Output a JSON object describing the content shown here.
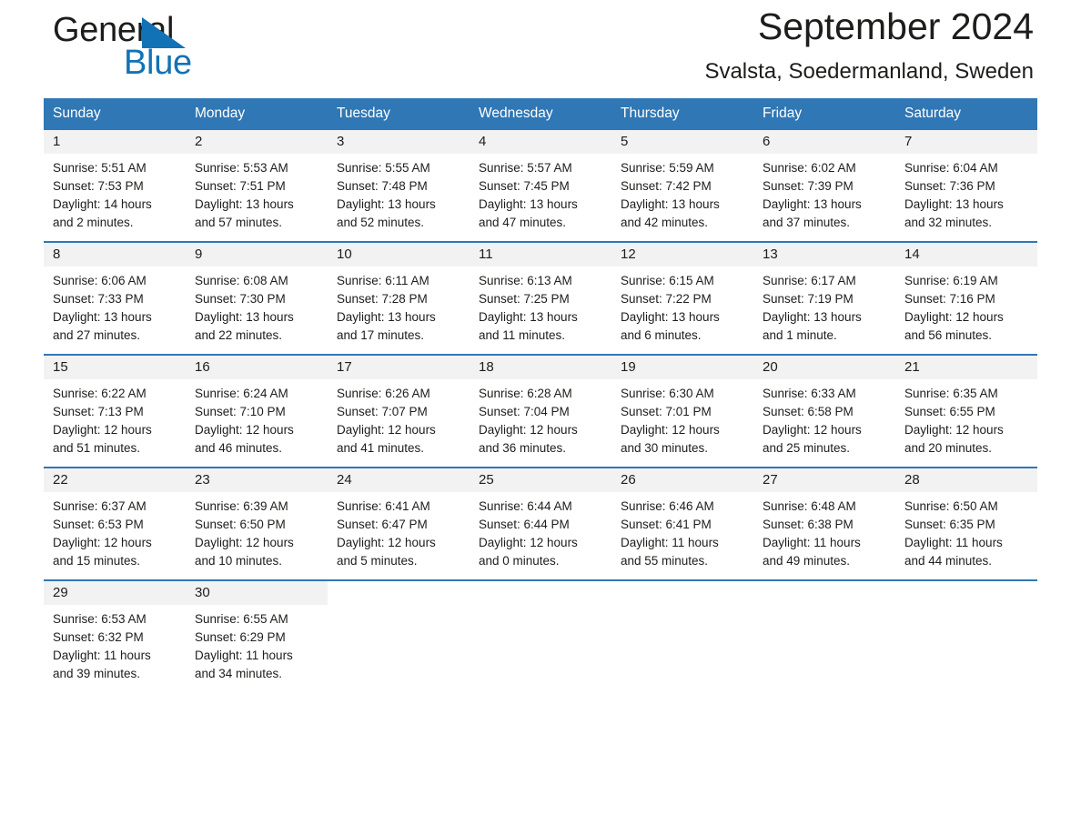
{
  "brand": {
    "name_part1": "General",
    "name_part2": "Blue",
    "triangle_color": "#1272b6",
    "accent_color": "#3077b5"
  },
  "header": {
    "month_title": "September 2024",
    "location": "Svalsta, Soedermanland, Sweden"
  },
  "calendar": {
    "weekday_headers": [
      "Sunday",
      "Monday",
      "Tuesday",
      "Wednesday",
      "Thursday",
      "Friday",
      "Saturday"
    ],
    "weeks": [
      [
        {
          "day": "1",
          "sunrise": "Sunrise: 5:51 AM",
          "sunset": "Sunset: 7:53 PM",
          "daylight1": "Daylight: 14 hours",
          "daylight2": "and 2 minutes."
        },
        {
          "day": "2",
          "sunrise": "Sunrise: 5:53 AM",
          "sunset": "Sunset: 7:51 PM",
          "daylight1": "Daylight: 13 hours",
          "daylight2": "and 57 minutes."
        },
        {
          "day": "3",
          "sunrise": "Sunrise: 5:55 AM",
          "sunset": "Sunset: 7:48 PM",
          "daylight1": "Daylight: 13 hours",
          "daylight2": "and 52 minutes."
        },
        {
          "day": "4",
          "sunrise": "Sunrise: 5:57 AM",
          "sunset": "Sunset: 7:45 PM",
          "daylight1": "Daylight: 13 hours",
          "daylight2": "and 47 minutes."
        },
        {
          "day": "5",
          "sunrise": "Sunrise: 5:59 AM",
          "sunset": "Sunset: 7:42 PM",
          "daylight1": "Daylight: 13 hours",
          "daylight2": "and 42 minutes."
        },
        {
          "day": "6",
          "sunrise": "Sunrise: 6:02 AM",
          "sunset": "Sunset: 7:39 PM",
          "daylight1": "Daylight: 13 hours",
          "daylight2": "and 37 minutes."
        },
        {
          "day": "7",
          "sunrise": "Sunrise: 6:04 AM",
          "sunset": "Sunset: 7:36 PM",
          "daylight1": "Daylight: 13 hours",
          "daylight2": "and 32 minutes."
        }
      ],
      [
        {
          "day": "8",
          "sunrise": "Sunrise: 6:06 AM",
          "sunset": "Sunset: 7:33 PM",
          "daylight1": "Daylight: 13 hours",
          "daylight2": "and 27 minutes."
        },
        {
          "day": "9",
          "sunrise": "Sunrise: 6:08 AM",
          "sunset": "Sunset: 7:30 PM",
          "daylight1": "Daylight: 13 hours",
          "daylight2": "and 22 minutes."
        },
        {
          "day": "10",
          "sunrise": "Sunrise: 6:11 AM",
          "sunset": "Sunset: 7:28 PM",
          "daylight1": "Daylight: 13 hours",
          "daylight2": "and 17 minutes."
        },
        {
          "day": "11",
          "sunrise": "Sunrise: 6:13 AM",
          "sunset": "Sunset: 7:25 PM",
          "daylight1": "Daylight: 13 hours",
          "daylight2": "and 11 minutes."
        },
        {
          "day": "12",
          "sunrise": "Sunrise: 6:15 AM",
          "sunset": "Sunset: 7:22 PM",
          "daylight1": "Daylight: 13 hours",
          "daylight2": "and 6 minutes."
        },
        {
          "day": "13",
          "sunrise": "Sunrise: 6:17 AM",
          "sunset": "Sunset: 7:19 PM",
          "daylight1": "Daylight: 13 hours",
          "daylight2": "and 1 minute."
        },
        {
          "day": "14",
          "sunrise": "Sunrise: 6:19 AM",
          "sunset": "Sunset: 7:16 PM",
          "daylight1": "Daylight: 12 hours",
          "daylight2": "and 56 minutes."
        }
      ],
      [
        {
          "day": "15",
          "sunrise": "Sunrise: 6:22 AM",
          "sunset": "Sunset: 7:13 PM",
          "daylight1": "Daylight: 12 hours",
          "daylight2": "and 51 minutes."
        },
        {
          "day": "16",
          "sunrise": "Sunrise: 6:24 AM",
          "sunset": "Sunset: 7:10 PM",
          "daylight1": "Daylight: 12 hours",
          "daylight2": "and 46 minutes."
        },
        {
          "day": "17",
          "sunrise": "Sunrise: 6:26 AM",
          "sunset": "Sunset: 7:07 PM",
          "daylight1": "Daylight: 12 hours",
          "daylight2": "and 41 minutes."
        },
        {
          "day": "18",
          "sunrise": "Sunrise: 6:28 AM",
          "sunset": "Sunset: 7:04 PM",
          "daylight1": "Daylight: 12 hours",
          "daylight2": "and 36 minutes."
        },
        {
          "day": "19",
          "sunrise": "Sunrise: 6:30 AM",
          "sunset": "Sunset: 7:01 PM",
          "daylight1": "Daylight: 12 hours",
          "daylight2": "and 30 minutes."
        },
        {
          "day": "20",
          "sunrise": "Sunrise: 6:33 AM",
          "sunset": "Sunset: 6:58 PM",
          "daylight1": "Daylight: 12 hours",
          "daylight2": "and 25 minutes."
        },
        {
          "day": "21",
          "sunrise": "Sunrise: 6:35 AM",
          "sunset": "Sunset: 6:55 PM",
          "daylight1": "Daylight: 12 hours",
          "daylight2": "and 20 minutes."
        }
      ],
      [
        {
          "day": "22",
          "sunrise": "Sunrise: 6:37 AM",
          "sunset": "Sunset: 6:53 PM",
          "daylight1": "Daylight: 12 hours",
          "daylight2": "and 15 minutes."
        },
        {
          "day": "23",
          "sunrise": "Sunrise: 6:39 AM",
          "sunset": "Sunset: 6:50 PM",
          "daylight1": "Daylight: 12 hours",
          "daylight2": "and 10 minutes."
        },
        {
          "day": "24",
          "sunrise": "Sunrise: 6:41 AM",
          "sunset": "Sunset: 6:47 PM",
          "daylight1": "Daylight: 12 hours",
          "daylight2": "and 5 minutes."
        },
        {
          "day": "25",
          "sunrise": "Sunrise: 6:44 AM",
          "sunset": "Sunset: 6:44 PM",
          "daylight1": "Daylight: 12 hours",
          "daylight2": "and 0 minutes."
        },
        {
          "day": "26",
          "sunrise": "Sunrise: 6:46 AM",
          "sunset": "Sunset: 6:41 PM",
          "daylight1": "Daylight: 11 hours",
          "daylight2": "and 55 minutes."
        },
        {
          "day": "27",
          "sunrise": "Sunrise: 6:48 AM",
          "sunset": "Sunset: 6:38 PM",
          "daylight1": "Daylight: 11 hours",
          "daylight2": "and 49 minutes."
        },
        {
          "day": "28",
          "sunrise": "Sunrise: 6:50 AM",
          "sunset": "Sunset: 6:35 PM",
          "daylight1": "Daylight: 11 hours",
          "daylight2": "and 44 minutes."
        }
      ],
      [
        {
          "day": "29",
          "sunrise": "Sunrise: 6:53 AM",
          "sunset": "Sunset: 6:32 PM",
          "daylight1": "Daylight: 11 hours",
          "daylight2": "and 39 minutes."
        },
        {
          "day": "30",
          "sunrise": "Sunrise: 6:55 AM",
          "sunset": "Sunset: 6:29 PM",
          "daylight1": "Daylight: 11 hours",
          "daylight2": "and 34 minutes."
        },
        {
          "day": "",
          "sunrise": "",
          "sunset": "",
          "daylight1": "",
          "daylight2": ""
        },
        {
          "day": "",
          "sunrise": "",
          "sunset": "",
          "daylight1": "",
          "daylight2": ""
        },
        {
          "day": "",
          "sunrise": "",
          "sunset": "",
          "daylight1": "",
          "daylight2": ""
        },
        {
          "day": "",
          "sunrise": "",
          "sunset": "",
          "daylight1": "",
          "daylight2": ""
        },
        {
          "day": "",
          "sunrise": "",
          "sunset": "",
          "daylight1": "",
          "daylight2": ""
        }
      ]
    ]
  }
}
